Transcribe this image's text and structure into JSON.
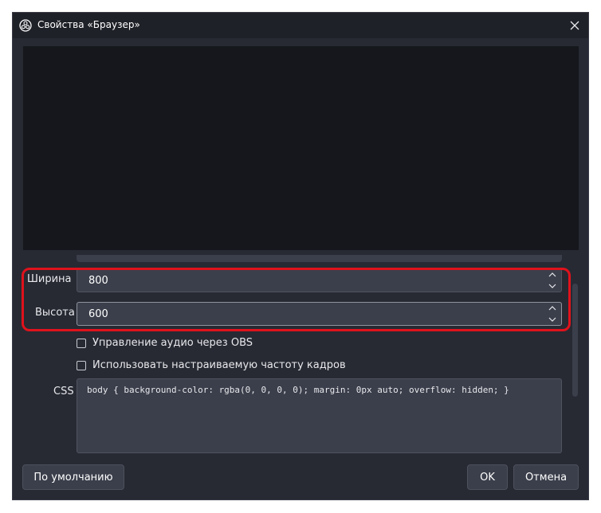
{
  "window": {
    "title": "Свойства «Браузер»"
  },
  "fields": {
    "width_label": "Ширина",
    "width_value": "800",
    "height_label": "Высота",
    "height_value": "600"
  },
  "options": {
    "audio_control": "Управление аудио через OBS",
    "custom_fps": "Использовать настраиваемую частоту кадров"
  },
  "css": {
    "label": "CSS",
    "value": "body { background-color: rgba(0, 0, 0, 0); margin: 0px auto; overflow: hidden; }"
  },
  "buttons": {
    "defaults": "По умолчанию",
    "ok": "OK",
    "cancel": "Отмена"
  },
  "icons": {
    "app": "obs-logo-icon",
    "close": "close-icon",
    "up": "chevron-up-icon",
    "down": "chevron-down-icon"
  },
  "colors": {
    "window_bg": "#272a33",
    "preview_bg": "#15171c",
    "input_bg": "#3b3f4b",
    "highlight": "#e0121c"
  }
}
